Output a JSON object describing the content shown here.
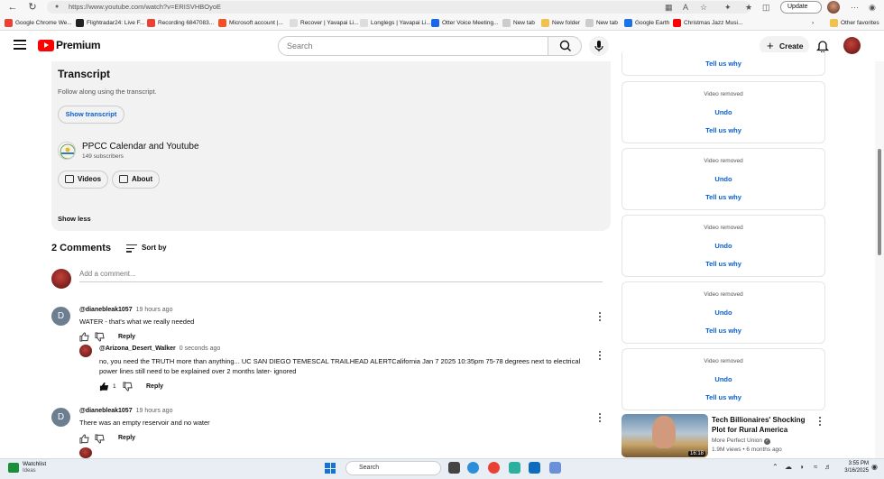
{
  "browser": {
    "url": "https://www.youtube.com/watch?v=ERISVHBOyoE",
    "update_label": "Update",
    "bookmarks": [
      {
        "label": "Google Chrome We...",
        "color": "#e94235"
      },
      {
        "label": "Flightradar24: Live F...",
        "color": "#222222"
      },
      {
        "label": "Recording 6847083...",
        "color": "#e94235"
      },
      {
        "label": "Microsoft account |...",
        "color": "#f25022"
      },
      {
        "label": "Recover | Yavapai Li...",
        "color": "#dddddd"
      },
      {
        "label": "Longlegs | Yavapai Li...",
        "color": "#dddddd"
      },
      {
        "label": "Otter Voice Meeting...",
        "color": "#1a66e8"
      },
      {
        "label": "New tab",
        "color": "#cccccc"
      },
      {
        "label": "New folder",
        "color": "#f0c24b"
      },
      {
        "label": "New tab",
        "color": "#cccccc"
      },
      {
        "label": "Google Earth",
        "color": "#1a73e8"
      },
      {
        "label": "Christmas Jazz Musi...",
        "color": "#ff0000"
      }
    ],
    "other_favorites": "Other favorites"
  },
  "header": {
    "logo_text": "Premium",
    "search_placeholder": "Search",
    "create_label": "Create"
  },
  "description": {
    "transcript_title": "Transcript",
    "transcript_sub": "Follow along using the transcript.",
    "show_transcript": "Show transcript",
    "channel_name": "PPCC Calendar and Youtube",
    "subscribers": "149 subscribers",
    "videos_label": "Videos",
    "about_label": "About",
    "show_less": "Show less"
  },
  "comments": {
    "count_label": "2 Comments",
    "sort_label": "Sort by",
    "add_placeholder": "Add a comment...",
    "items": [
      {
        "avatar_letter": "D",
        "author": "@dianebleak1057",
        "time": "19 hours ago",
        "text": "WATER - that's what we really needed",
        "reply_label": "Reply"
      },
      {
        "author": "@Arizona_Desert_Walker",
        "time": "0 seconds ago",
        "text": "no, you need the TRUTH more than anything... UC SAN DIEGO TEMESCAL TRAILHEAD ALERTCalifornia Jan 7 2025 10:35pm 75-78 degrees next to electrical power lines still need to be explained over 2 months later- ignored",
        "likes": "1",
        "reply_label": "Reply"
      },
      {
        "avatar_letter": "D",
        "author": "@dianebleak1057",
        "time": "19 hours ago",
        "text": "There was an empty reservoir and no water",
        "reply_label": "Reply"
      }
    ]
  },
  "sidebar": {
    "top_tell_us_why": "Tell us why",
    "removed_cards": [
      {
        "label": "Video removed",
        "undo": "Undo",
        "why": "Tell us why"
      },
      {
        "label": "Video removed",
        "undo": "Undo",
        "why": "Tell us why"
      },
      {
        "label": "Video removed",
        "undo": "Undo",
        "why": "Tell us why"
      },
      {
        "label": "Video removed",
        "undo": "Undo",
        "why": "Tell us why"
      },
      {
        "label": "Video removed",
        "undo": "Undo",
        "why": "Tell us why"
      }
    ],
    "video": {
      "title": "Tech Billionaires' Shocking Plot for Rural America",
      "channel": "More Perfect Union",
      "meta": "1.9M views • 6 months ago",
      "duration": "16:18"
    }
  },
  "taskbar": {
    "watchlist_title": "Watchlist",
    "watchlist_sub": "Ideas",
    "search_label": "Search",
    "time": "3:55 PM",
    "date": "3/16/2025"
  }
}
